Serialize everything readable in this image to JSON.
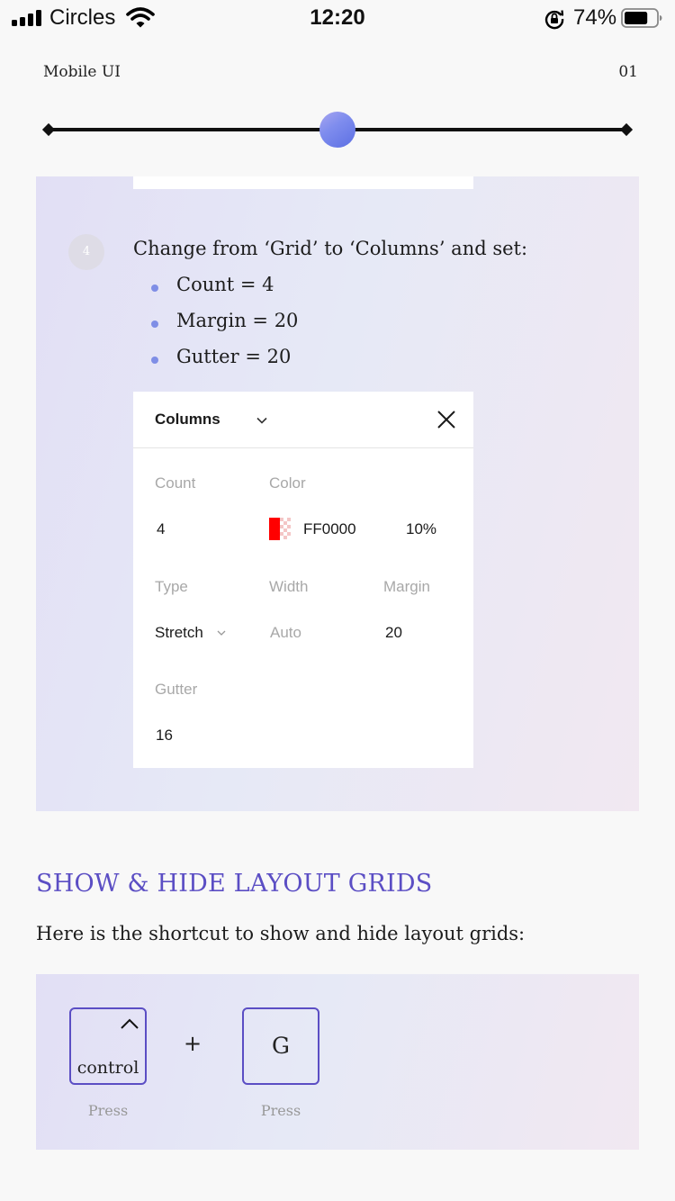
{
  "status_bar": {
    "carrier": "Circles",
    "time": "12:20",
    "battery_percent": "74%",
    "battery_level": 0.74,
    "signal_bars": 4,
    "icons": [
      "signal-icon",
      "wifi-icon",
      "rotation-lock-icon",
      "battery-icon"
    ]
  },
  "header": {
    "title": "Mobile UI",
    "page_number": "01"
  },
  "progress_slider": {
    "value": 0.5
  },
  "step": {
    "number": "4",
    "instruction": "Change from ‘Grid’ to ‘Columns’ and set:",
    "bullets": [
      "Count = 4",
      "Margin = 20",
      "Gutter = 20"
    ]
  },
  "columns_card": {
    "title": "Columns",
    "fields": {
      "count": {
        "label": "Count",
        "value": "4"
      },
      "color": {
        "label": "Color",
        "hex": "FF0000",
        "opacity": "10%",
        "swatch": "#ff0000"
      },
      "type": {
        "label": "Type",
        "value": "Stretch"
      },
      "width": {
        "label": "Width",
        "value": "Auto"
      },
      "margin": {
        "label": "Margin",
        "value": "20"
      },
      "gutter": {
        "label": "Gutter",
        "value": "16"
      }
    }
  },
  "section": {
    "title": "SHOW & HIDE LAYOUT GRIDS",
    "description": "Here is the shortcut to show and hide layout grids:"
  },
  "shortcut": {
    "key1": {
      "label": "control",
      "hint": "Press"
    },
    "separator": "+",
    "key2": {
      "label": "G",
      "hint": "Press"
    }
  },
  "colors": {
    "accent": "#5b4ec4",
    "bullet": "#7f8ee6",
    "panel_bg": "#e6e4f5"
  }
}
